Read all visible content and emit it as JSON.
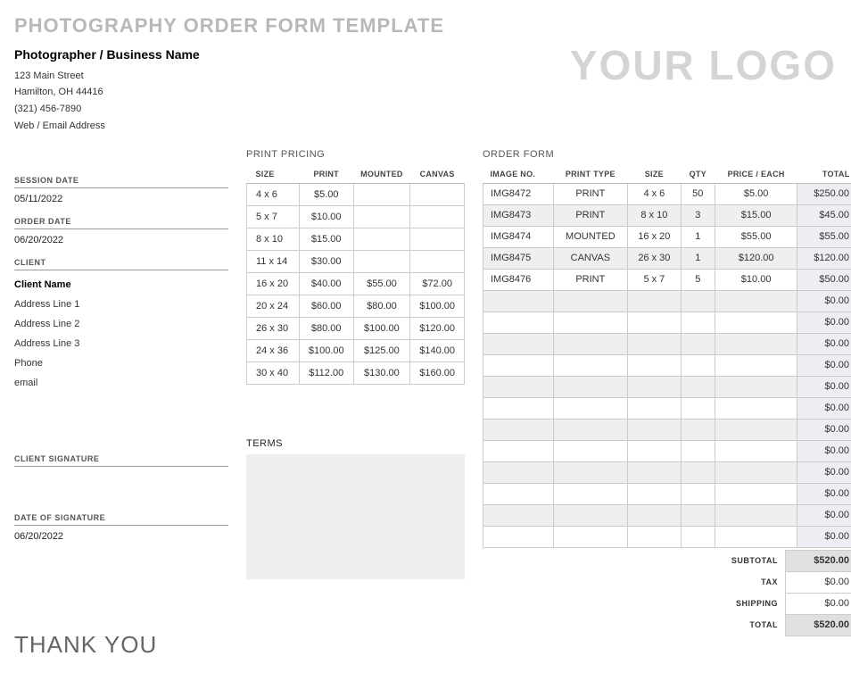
{
  "title": "PHOTOGRAPHY ORDER FORM TEMPLATE",
  "logo": "YOUR LOGO",
  "business": {
    "name": "Photographer / Business Name",
    "addr1": "123 Main Street",
    "addr2": "Hamilton, OH 44416",
    "phone": "(321) 456-7890",
    "web": "Web / Email Address"
  },
  "labels": {
    "session_date": "SESSION DATE",
    "order_date": "ORDER DATE",
    "client": "CLIENT",
    "client_signature": "CLIENT SIGNATURE",
    "date_of_signature": "DATE OF SIGNATURE",
    "print_pricing": "PRINT PRICING",
    "order_form": "ORDER FORM",
    "terms": "TERMS",
    "thankyou": "THANK YOU",
    "subtotal": "SUBTOTAL",
    "tax": "TAX",
    "shipping": "SHIPPING",
    "total": "TOTAL"
  },
  "session_date": "05/11/2022",
  "order_date": "06/20/2022",
  "client": {
    "name": "Client Name",
    "addr1": "Address Line 1",
    "addr2": "Address Line 2",
    "addr3": "Address Line 3",
    "phone": "Phone",
    "email": "email"
  },
  "date_of_signature": "06/20/2022",
  "pricing_headers": {
    "size": "SIZE",
    "print": "PRINT",
    "mounted": "MOUNTED",
    "canvas": "CANVAS"
  },
  "pricing": [
    {
      "size": "4 x 6",
      "print": "$5.00",
      "mounted": "",
      "canvas": ""
    },
    {
      "size": "5 x 7",
      "print": "$10.00",
      "mounted": "",
      "canvas": ""
    },
    {
      "size": "8 x 10",
      "print": "$15.00",
      "mounted": "",
      "canvas": ""
    },
    {
      "size": "11 x 14",
      "print": "$30.00",
      "mounted": "",
      "canvas": ""
    },
    {
      "size": "16 x 20",
      "print": "$40.00",
      "mounted": "$55.00",
      "canvas": "$72.00"
    },
    {
      "size": "20 x 24",
      "print": "$60.00",
      "mounted": "$80.00",
      "canvas": "$100.00"
    },
    {
      "size": "26 x 30",
      "print": "$80.00",
      "mounted": "$100.00",
      "canvas": "$120.00"
    },
    {
      "size": "24 x 36",
      "print": "$100.00",
      "mounted": "$125.00",
      "canvas": "$140.00"
    },
    {
      "size": "30 x 40",
      "print": "$112.00",
      "mounted": "$130.00",
      "canvas": "$160.00"
    }
  ],
  "order_headers": {
    "img": "IMAGE NO.",
    "type": "PRINT TYPE",
    "size": "SIZE",
    "qty": "QTY",
    "price": "PRICE / EACH",
    "total": "TOTAL"
  },
  "orders": [
    {
      "img": "IMG8472",
      "type": "PRINT",
      "size": "4 x 6",
      "qty": "50",
      "price": "$5.00",
      "total": "$250.00"
    },
    {
      "img": "IMG8473",
      "type": "PRINT",
      "size": "8 x 10",
      "qty": "3",
      "price": "$15.00",
      "total": "$45.00"
    },
    {
      "img": "IMG8474",
      "type": "MOUNTED",
      "size": "16 x 20",
      "qty": "1",
      "price": "$55.00",
      "total": "$55.00"
    },
    {
      "img": "IMG8475",
      "type": "CANVAS",
      "size": "26 x 30",
      "qty": "1",
      "price": "$120.00",
      "total": "$120.00"
    },
    {
      "img": "IMG8476",
      "type": "PRINT",
      "size": "5 x 7",
      "qty": "5",
      "price": "$10.00",
      "total": "$50.00"
    },
    {
      "img": "",
      "type": "",
      "size": "",
      "qty": "",
      "price": "",
      "total": "$0.00"
    },
    {
      "img": "",
      "type": "",
      "size": "",
      "qty": "",
      "price": "",
      "total": "$0.00"
    },
    {
      "img": "",
      "type": "",
      "size": "",
      "qty": "",
      "price": "",
      "total": "$0.00"
    },
    {
      "img": "",
      "type": "",
      "size": "",
      "qty": "",
      "price": "",
      "total": "$0.00"
    },
    {
      "img": "",
      "type": "",
      "size": "",
      "qty": "",
      "price": "",
      "total": "$0.00"
    },
    {
      "img": "",
      "type": "",
      "size": "",
      "qty": "",
      "price": "",
      "total": "$0.00"
    },
    {
      "img": "",
      "type": "",
      "size": "",
      "qty": "",
      "price": "",
      "total": "$0.00"
    },
    {
      "img": "",
      "type": "",
      "size": "",
      "qty": "",
      "price": "",
      "total": "$0.00"
    },
    {
      "img": "",
      "type": "",
      "size": "",
      "qty": "",
      "price": "",
      "total": "$0.00"
    },
    {
      "img": "",
      "type": "",
      "size": "",
      "qty": "",
      "price": "",
      "total": "$0.00"
    },
    {
      "img": "",
      "type": "",
      "size": "",
      "qty": "",
      "price": "",
      "total": "$0.00"
    },
    {
      "img": "",
      "type": "",
      "size": "",
      "qty": "",
      "price": "",
      "total": "$0.00"
    }
  ],
  "summary": {
    "subtotal": "$520.00",
    "tax": "$0.00",
    "shipping": "$0.00",
    "total": "$520.00"
  }
}
